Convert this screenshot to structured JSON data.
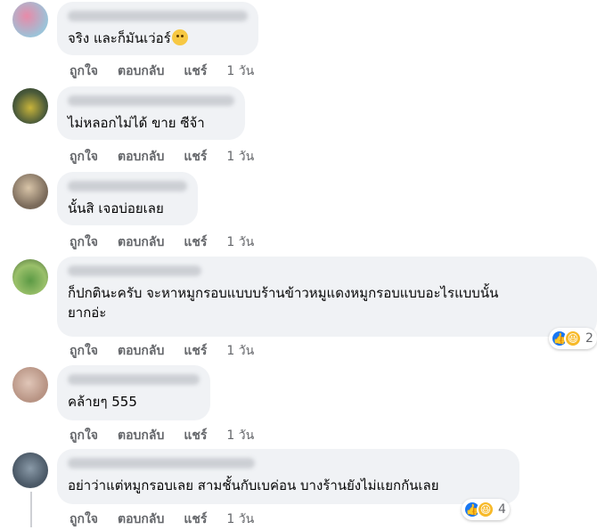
{
  "labels": {
    "like": "ถูกใจ",
    "reply": "ตอบกลับ",
    "share": "แชร์",
    "time": "1 วัน"
  },
  "comments": [
    {
      "text": "จริง และก็มันเว่อร์",
      "emoji": "slightly-smiling-face"
    },
    {
      "text": "ไม่หลอกไม่ได้ ขาย ซีจ้า"
    },
    {
      "text": "นั้นสิ เจอบ่อยเลย"
    },
    {
      "text": "ก็ปกตินะครับ จะหาหมูกรอบแบบบร้านข้าวหมูแดงหมูกรอบแบบอะไรแบบนั้น\nยากอ่ะ",
      "reactions": {
        "types": [
          "like",
          "haha"
        ],
        "count": "2"
      }
    },
    {
      "text": "คล้ายๆ 555"
    },
    {
      "text": "อย่าว่าแต่หมูกรอบเลย สามชั้นกับเบค่อน บางร้านยังไม่แยกกันเลย",
      "reactions": {
        "types": [
          "like",
          "haha"
        ],
        "count": "4"
      }
    }
  ],
  "colors": {
    "bubble": "#f0f2f5",
    "meta": "#65676b",
    "like_blue": "#1877f2",
    "haha_yellow": "#f7b928"
  }
}
